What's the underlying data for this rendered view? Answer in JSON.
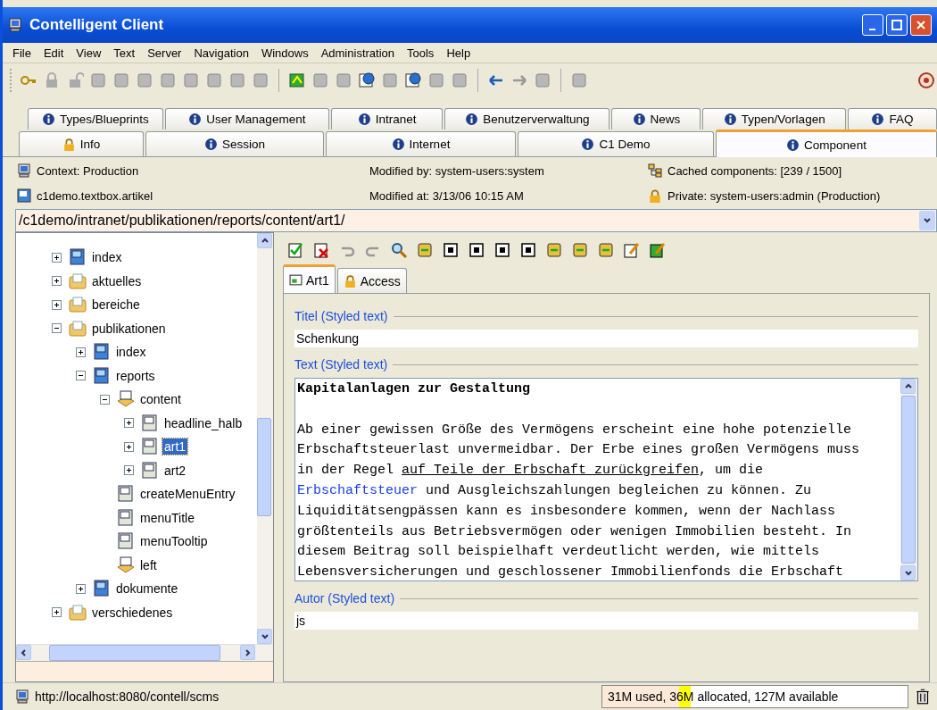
{
  "window": {
    "title": "Contelligent Client"
  },
  "menu": [
    "File",
    "Edit",
    "View",
    "Text",
    "Server",
    "Navigation",
    "Windows",
    "Administration",
    "Tools",
    "Help"
  ],
  "tabs_row_1": [
    {
      "label": "Types/Blueprints",
      "kind": "info",
      "selected": false
    },
    {
      "label": "User Management",
      "kind": "info",
      "selected": false
    },
    {
      "label": "Intranet",
      "kind": "info",
      "selected": false
    },
    {
      "label": "Benutzerverwaltung",
      "kind": "info",
      "selected": false
    },
    {
      "label": "News",
      "kind": "info",
      "selected": false
    },
    {
      "label": "Typen/Vorlagen",
      "kind": "info",
      "selected": false
    },
    {
      "label": "FAQ",
      "kind": "info",
      "selected": false
    }
  ],
  "tabs_row_2": [
    {
      "label": "Info",
      "kind": "lock",
      "selected": false
    },
    {
      "label": "Session",
      "kind": "info",
      "selected": false
    },
    {
      "label": "Internet",
      "kind": "info",
      "selected": false
    },
    {
      "label": "C1 Demo",
      "kind": "info",
      "selected": false
    },
    {
      "label": "Component",
      "kind": "info",
      "selected": true
    }
  ],
  "info": {
    "context": "Context: Production",
    "modified_by": "Modified by: system-users:system",
    "cached": "Cached components: [239 / 1500]",
    "component": "c1demo.textbox.artikel",
    "modified_at": "Modified at: 3/13/06 10:15 AM",
    "private": "Private: system-users:admin (Production)"
  },
  "path": "/c1demo/intranet/publikationen/reports/content/art1/",
  "tree": [
    {
      "label": "index",
      "kind": "page",
      "expanded": false,
      "selected": false
    },
    {
      "label": "aktuelles",
      "kind": "folder",
      "expanded": false,
      "selected": false
    },
    {
      "label": "bereiche",
      "kind": "folder",
      "expanded": false,
      "selected": false
    },
    {
      "label": "publikationen",
      "kind": "folder",
      "expanded": true,
      "selected": false,
      "children": [
        {
          "label": "index",
          "kind": "page",
          "expanded": false,
          "selected": false
        },
        {
          "label": "reports",
          "kind": "page",
          "expanded": true,
          "selected": false,
          "children": [
            {
              "label": "content",
              "kind": "container",
              "expanded": true,
              "selected": false,
              "children": [
                {
                  "label": "headline_halb",
                  "kind": "item",
                  "expanded": false,
                  "selected": false
                },
                {
                  "label": "art1",
                  "kind": "item",
                  "expanded": false,
                  "selected": true
                },
                {
                  "label": "art2",
                  "kind": "item",
                  "expanded": false,
                  "selected": false
                }
              ]
            },
            {
              "label": "createMenuEntry",
              "kind": "leaf",
              "selected": false
            },
            {
              "label": "menuTitle",
              "kind": "leaf",
              "selected": false
            },
            {
              "label": "menuTooltip",
              "kind": "leaf",
              "selected": false
            },
            {
              "label": "left",
              "kind": "leafcontainer",
              "selected": false
            }
          ]
        },
        {
          "label": "dokumente",
          "kind": "page",
          "expanded": false,
          "selected": false
        }
      ]
    },
    {
      "label": "verschiedenes",
      "kind": "folder",
      "expanded": false,
      "selected": false
    }
  ],
  "editor_tabs": [
    {
      "label": "Art1",
      "kind": "doc",
      "selected": true
    },
    {
      "label": "Access",
      "kind": "lock",
      "selected": false
    }
  ],
  "fields": [
    {
      "label": "Titel (Styled text)",
      "kind": "line",
      "value": "Schenkung"
    },
    {
      "label": "Text (Styled text)",
      "kind": "area",
      "paragraphs": [
        {
          "lines": [
            [
              {
                "text": "Kapitalanlagen zur Gestaltung",
                "kind": "bold"
              }
            ]
          ]
        },
        {
          "lines": [
            [
              {
                "text": "Ab einer gewissen Größe des Vermögens erscheint eine hohe potenzielle",
                "kind": "plain"
              }
            ],
            [
              {
                "text": "Erbschaftsteuerlast unvermeidbar. Der Erbe eines großen Vermögens muss",
                "kind": "plain"
              }
            ],
            [
              {
                "text": "in der Regel ",
                "kind": "plain"
              },
              {
                "text": "auf Teile der Erbschaft zurückgreifen",
                "kind": "underline"
              },
              {
                "text": ", um die",
                "kind": "plain"
              }
            ],
            [
              {
                "text": "Erbschaftsteuer",
                "kind": "link"
              },
              {
                "text": " und Ausgleichszahlungen begleichen zu können. Zu",
                "kind": "plain"
              }
            ],
            [
              {
                "text": "Liquiditätsengpässen kann es insbesondere kommen, wenn der Nachlass",
                "kind": "plain"
              }
            ],
            [
              {
                "text": "größtenteils aus Betriebsvermögen oder wenigen Immobilien besteht. In",
                "kind": "plain"
              }
            ],
            [
              {
                "text": "diesem Beitrag soll beispielhaft verdeutlicht werden, wie mittels",
                "kind": "plain"
              }
            ],
            [
              {
                "text": "Lebensversicherungen und geschlossener Immobilienfonds die Erbschaft",
                "kind": "plain"
              }
            ]
          ]
        }
      ]
    },
    {
      "label": "Autor (Styled text)",
      "kind": "line",
      "value": "js"
    }
  ],
  "status_bar": {
    "url": "http://localhost:8080/contell/scms",
    "memory": "31M used, 36M allocated, 127M available",
    "used": {
      "level": 0.25
    },
    "allocated": {
      "level": 0.29
    }
  }
}
